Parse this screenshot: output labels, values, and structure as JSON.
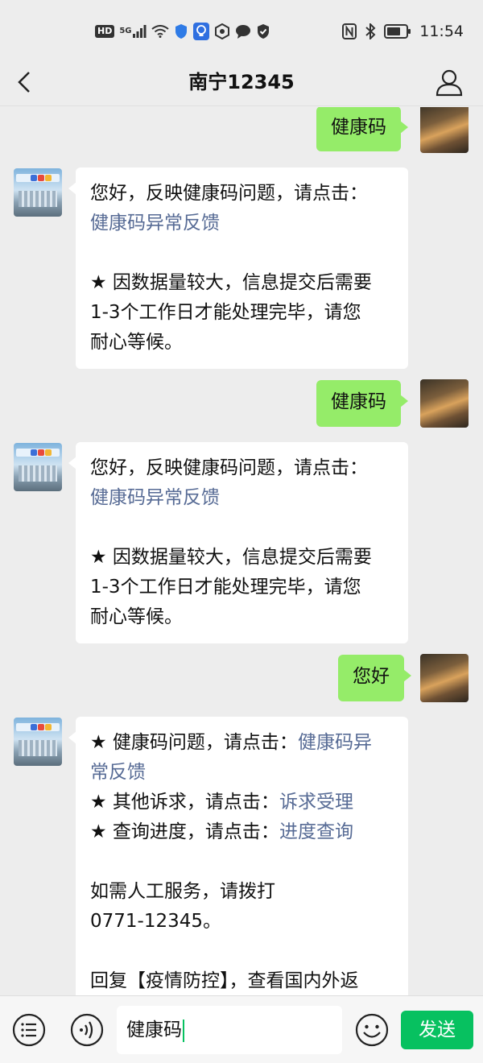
{
  "status_bar": {
    "hd": "HD",
    "signal_label": "5G",
    "time": "11:54",
    "icons": [
      "signal-icon",
      "wifi-icon",
      "shield-icon",
      "bulb-icon",
      "hexagon-icon",
      "chat-icon",
      "check-shield-icon",
      "nfc-icon",
      "bluetooth-icon",
      "battery-icon"
    ]
  },
  "nav": {
    "title": "南宁12345"
  },
  "messages": [
    {
      "from": "user",
      "text": "健康码"
    },
    {
      "from": "bot",
      "line1": "您好，反映健康码问题，请点击：",
      "link": "健康码异常反馈",
      "note1": "★ 因数据量较大，信息提交后需要",
      "note2": "1-3个工作日才能处理完毕，请您",
      "note3": "耐心等候。"
    },
    {
      "from": "user",
      "text": "健康码"
    },
    {
      "from": "bot",
      "line1": "您好，反映健康码问题，请点击：",
      "link": "健康码异常反馈",
      "note1": "★ 因数据量较大，信息提交后需要",
      "note2": "1-3个工作日才能处理完毕，请您",
      "note3": "耐心等候。"
    },
    {
      "from": "user",
      "text": "您好"
    },
    {
      "from": "bot",
      "item1_prefix": "★ 健康码问题，请点击：",
      "item1_link_a": "健康码异",
      "item1_link_b": "常反馈",
      "item2_prefix": "★ 其他诉求，请点击：",
      "item2_link": "诉求受理",
      "item3_prefix": "★ 查询进度，请点击：",
      "item3_link": "进度查询",
      "manual1": "如需人工服务，请拨打",
      "manual2": "0771-12345。",
      "reply": "回复【疫情防控】，查看国内外返"
    }
  ],
  "input_bar": {
    "input_value": "健康码",
    "send_label": "发送"
  },
  "colors": {
    "user_bubble": "#95ec69",
    "bot_bubble": "#ffffff",
    "link": "#576b95",
    "send_button": "#07c160",
    "background": "#ededed"
  }
}
